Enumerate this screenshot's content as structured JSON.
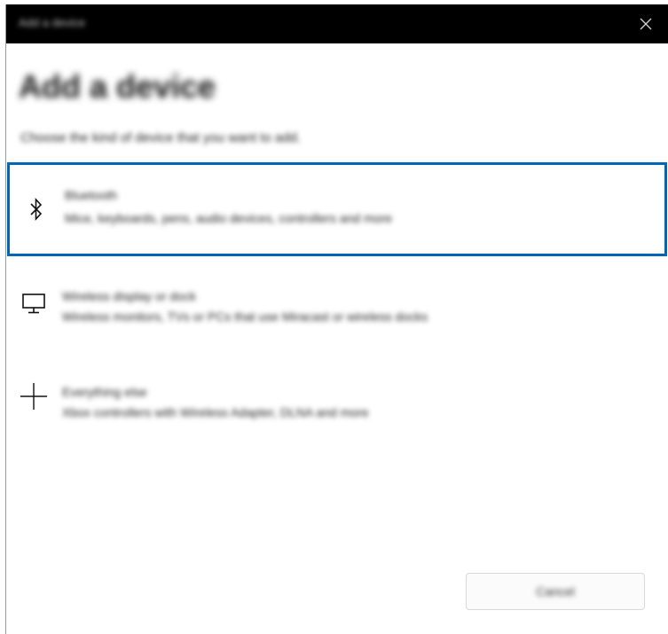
{
  "window": {
    "title": "Add a device"
  },
  "dialog": {
    "heading": "Add a device",
    "subheading": "Choose the kind of device that you want to add."
  },
  "options": [
    {
      "icon": "bluetooth-icon",
      "title": "Bluetooth",
      "description": "Mice, keyboards, pens, audio devices, controllers and more",
      "selected": true
    },
    {
      "icon": "monitor-icon",
      "title": "Wireless display or dock",
      "description": "Wireless monitors, TVs or PCs that use Miracast or wireless docks",
      "selected": false
    },
    {
      "icon": "plus-icon",
      "title": "Everything else",
      "description": "Xbox controllers with Wireless Adapter, DLNA and more",
      "selected": false
    }
  ],
  "footer": {
    "cancel_label": "Cancel"
  },
  "colors": {
    "accent": "#0067b8",
    "titlebar": "#000000"
  }
}
